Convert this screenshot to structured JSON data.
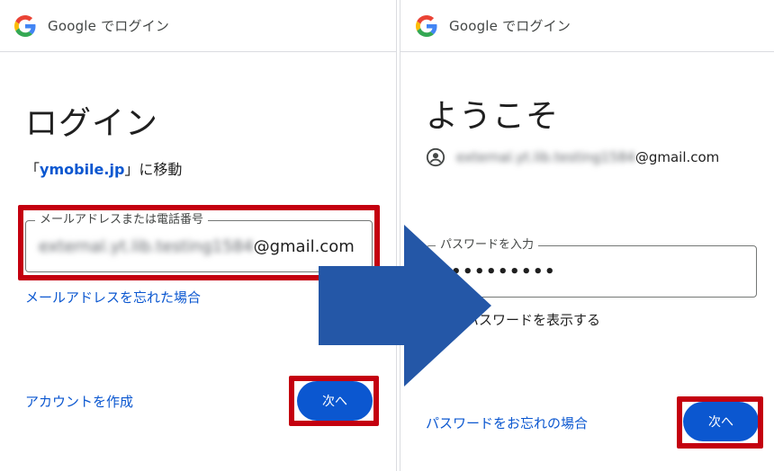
{
  "left": {
    "header_title": "Google でログイン",
    "heading": "ログイン",
    "subtitle_open": "「",
    "subtitle_link": "ymobile.jp",
    "subtitle_close": "」に移動",
    "field_label": "メールアドレスまたは電話番号",
    "field_value_blurred": "external.yt.lib.testing1584",
    "field_value_domain": "@gmail.com",
    "forgot_email": "メールアドレスを忘れた場合",
    "create_account": "アカウントを作成",
    "next_button": "次へ"
  },
  "right": {
    "header_title": "Google でログイン",
    "heading": "ようこそ",
    "account_blurred": "external.yt.lib.testing1584",
    "account_domain": "@gmail.com",
    "password_label": "パスワードを入力",
    "password_value": "••••••••••",
    "show_password": "パスワードを表示する",
    "forgot_password": "パスワードをお忘れの場合",
    "next_button": "次へ"
  },
  "colors": {
    "accent_blue": "#0b57d0",
    "annotation_red": "#c4000f",
    "arrow_blue": "#2457a7"
  },
  "icons": [
    "google-logo-icon",
    "account-circle-icon",
    "right-arrow-icon"
  ]
}
